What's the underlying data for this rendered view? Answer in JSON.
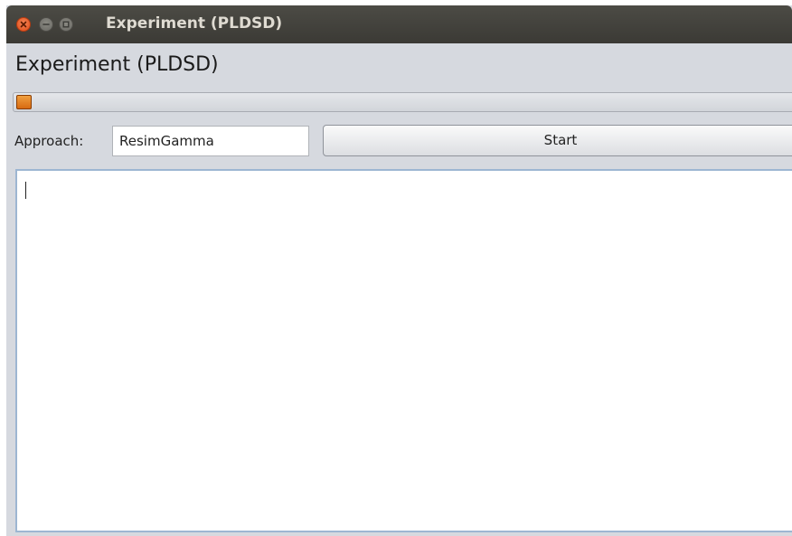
{
  "window": {
    "title": "Experiment (PLDSD)",
    "controls": {
      "close_icon": "close-icon",
      "minimize_icon": "minimize-icon",
      "maximize_icon": "maximize-icon"
    }
  },
  "header": {
    "heading": "Experiment (PLDSD)"
  },
  "progress": {
    "value_percent": 2,
    "fill_color": "#e07818"
  },
  "form": {
    "approach_label": "Approach:",
    "approach_value": "ResimGamma",
    "start_label": "Start"
  },
  "output": {
    "text": ""
  },
  "colors": {
    "titlebar": "#3f3e39",
    "window_bg": "#d6d9df",
    "close_button": "#e8571f",
    "progress_accent": "#e07818",
    "text_area_border": "#9db6d2"
  }
}
